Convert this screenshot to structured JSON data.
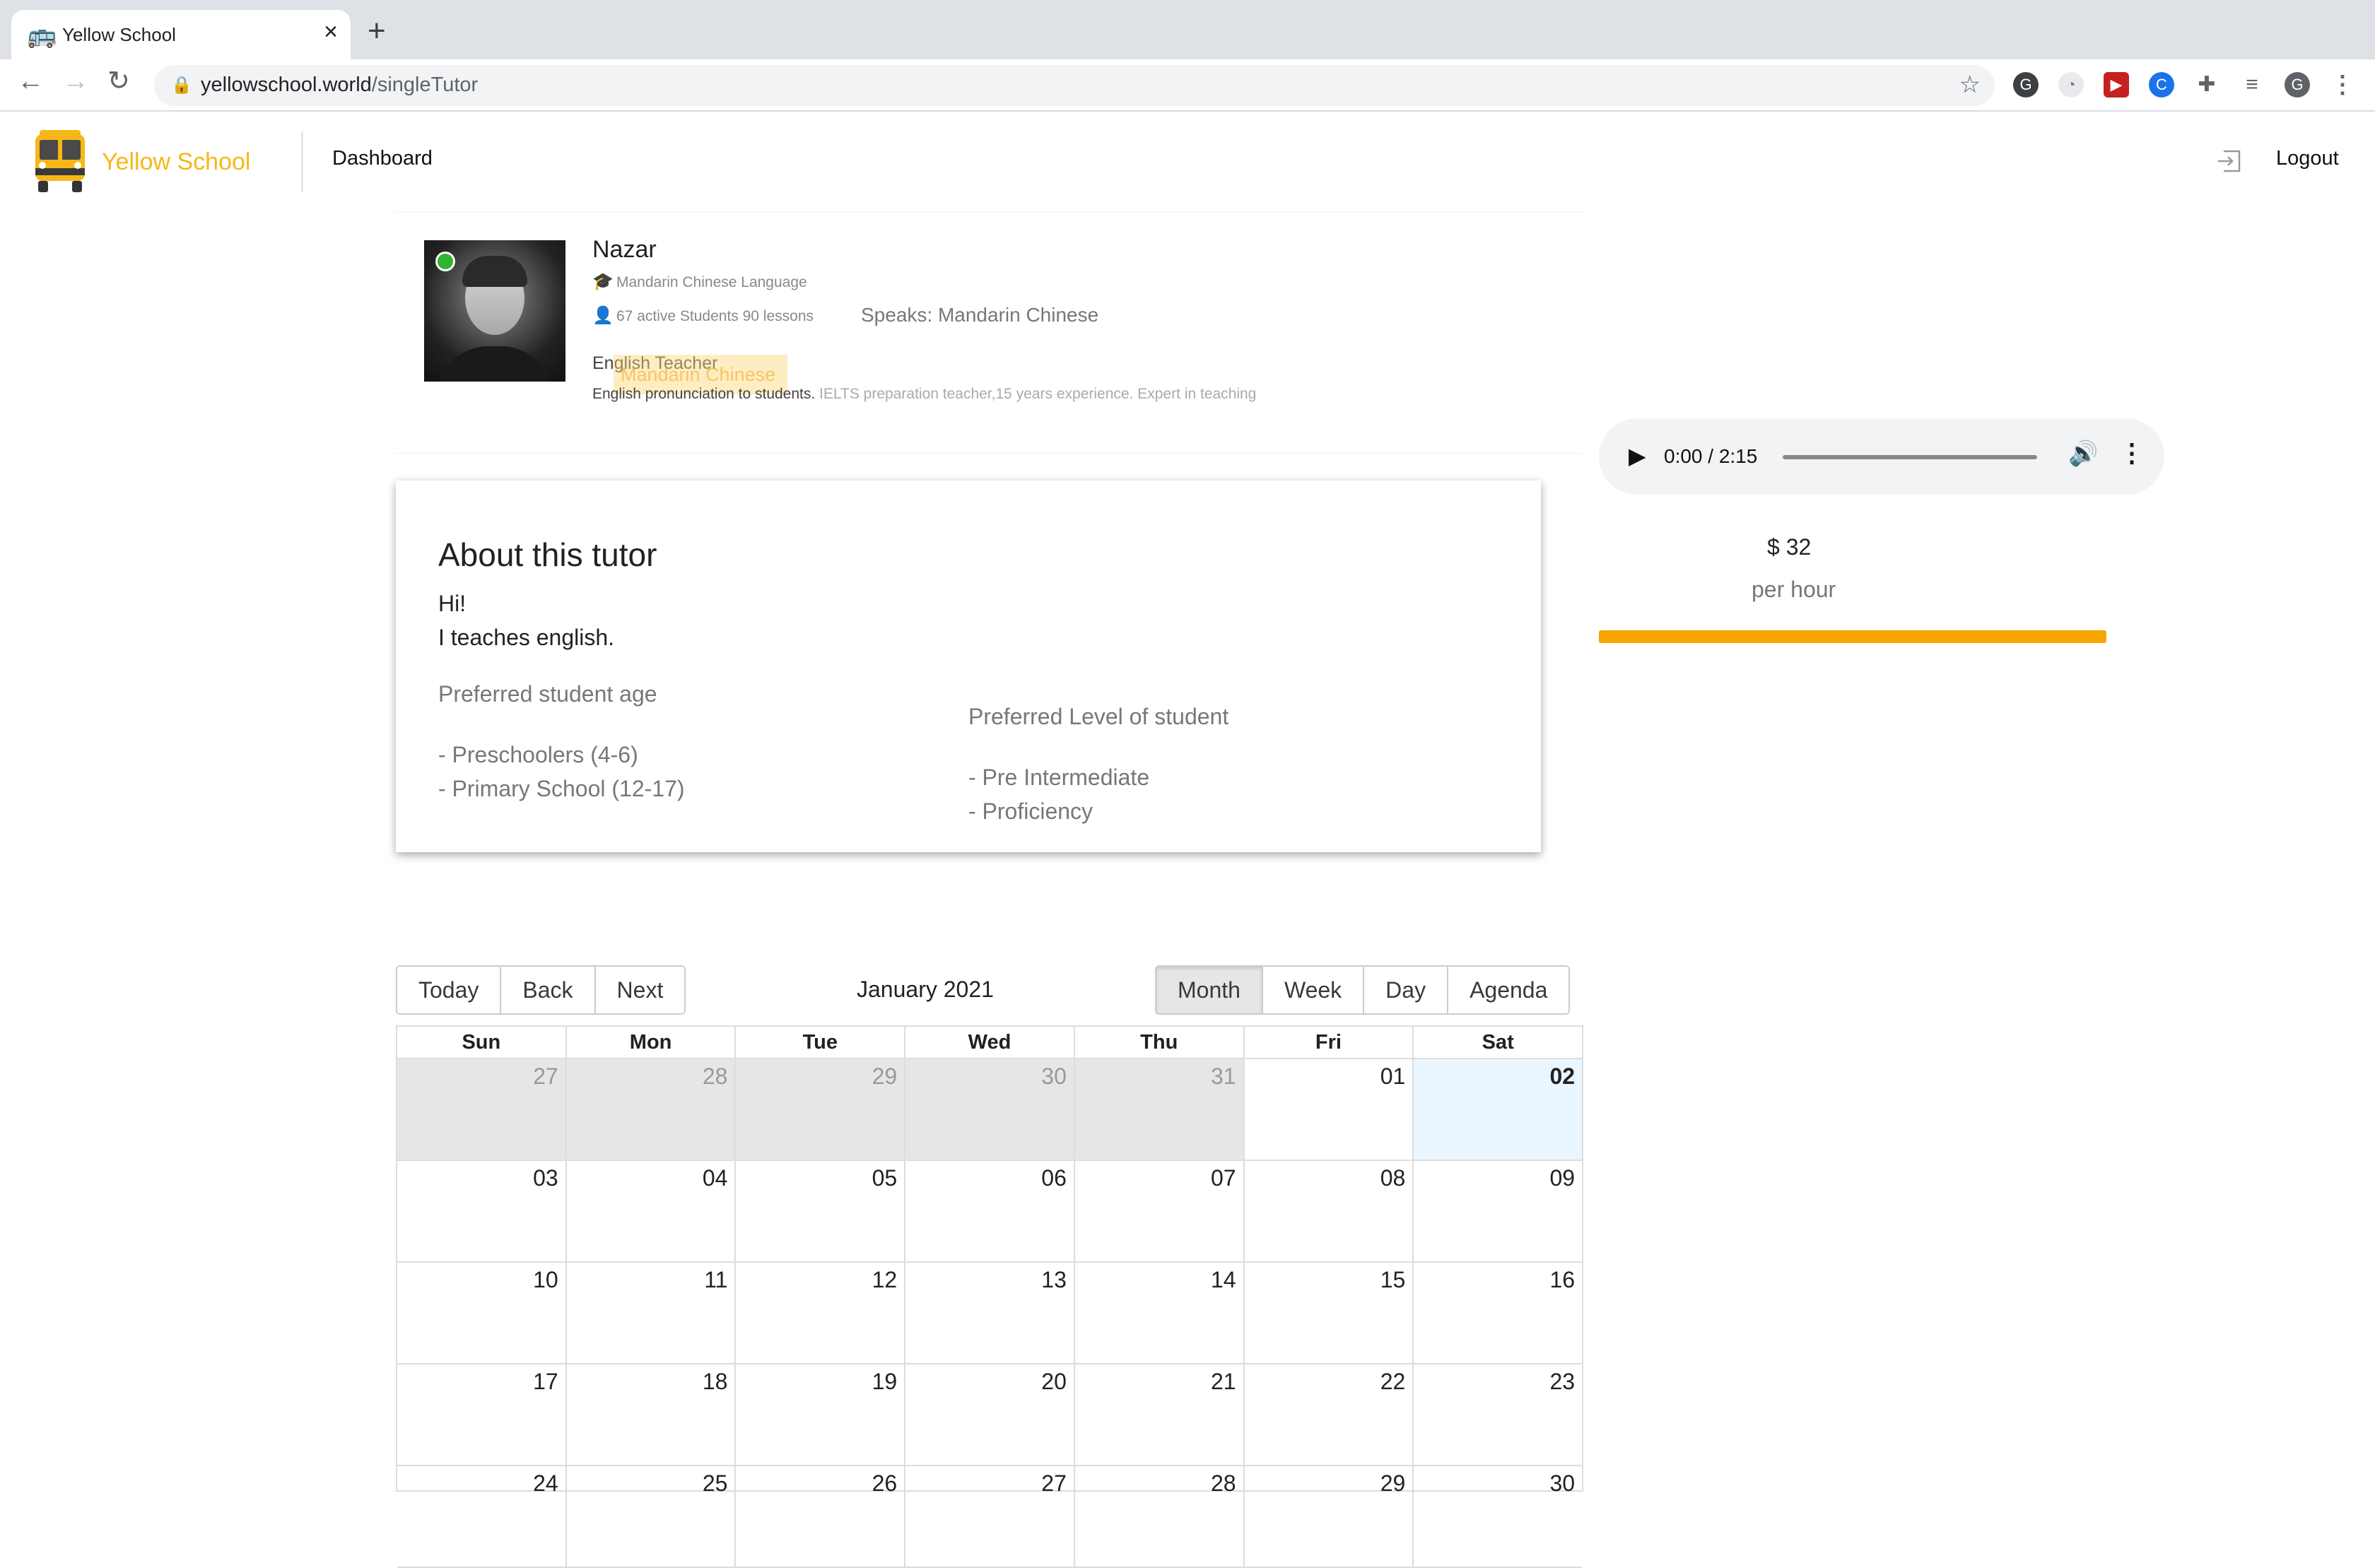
{
  "browser": {
    "tab_title": "Yellow School",
    "url_domain": "yellowschool.world",
    "url_path": "/singleTutor",
    "profile_initial": "G"
  },
  "header": {
    "logo_text": "Yellow School",
    "dashboard_label": "Dashboard",
    "logout_label": "Logout"
  },
  "tutor": {
    "name": "Nazar",
    "language": "Mandarin Chinese Language",
    "stats": "67 active Students 90 lessons",
    "speaks": "Speaks: Mandarin Chinese",
    "bio_title": "English Teacher",
    "bio_highlight": "Mandarin Chinese",
    "bio_dark": "English pronunciation to students.",
    "bio_rest": " IELTS preparation teacher,15 years experience. Expert in teaching",
    "online": true
  },
  "audio": {
    "time": "0:00 / 2:15"
  },
  "price": {
    "amount": "$ 32",
    "unit": "per hour",
    "accent": "#f7a600"
  },
  "about": {
    "title": "About this tutor",
    "line1": "Hi!",
    "line2": "I teaches english.",
    "age_heading": "Preferred student age",
    "ages": [
      "- Preschoolers (4-6)",
      "- Primary School (12-17)"
    ],
    "level_heading": "Preferred Level of student",
    "levels": [
      "- Pre Intermediate",
      "- Proficiency"
    ]
  },
  "calendar": {
    "nav": [
      "Today",
      "Back",
      "Next"
    ],
    "label": "January 2021",
    "views": [
      "Month",
      "Week",
      "Day",
      "Agenda"
    ],
    "active_view": "Month",
    "weekdays": [
      "Sun",
      "Mon",
      "Tue",
      "Wed",
      "Thu",
      "Fri",
      "Sat"
    ],
    "weeks": [
      [
        "27",
        "28",
        "29",
        "30",
        "31",
        "01",
        "02"
      ],
      [
        "03",
        "04",
        "05",
        "06",
        "07",
        "08",
        "09"
      ],
      [
        "10",
        "11",
        "12",
        "13",
        "14",
        "15",
        "16"
      ],
      [
        "17",
        "18",
        "19",
        "20",
        "21",
        "22",
        "23"
      ],
      [
        "24",
        "25",
        "26",
        "27",
        "28",
        "29",
        "30"
      ]
    ],
    "today": "02"
  }
}
